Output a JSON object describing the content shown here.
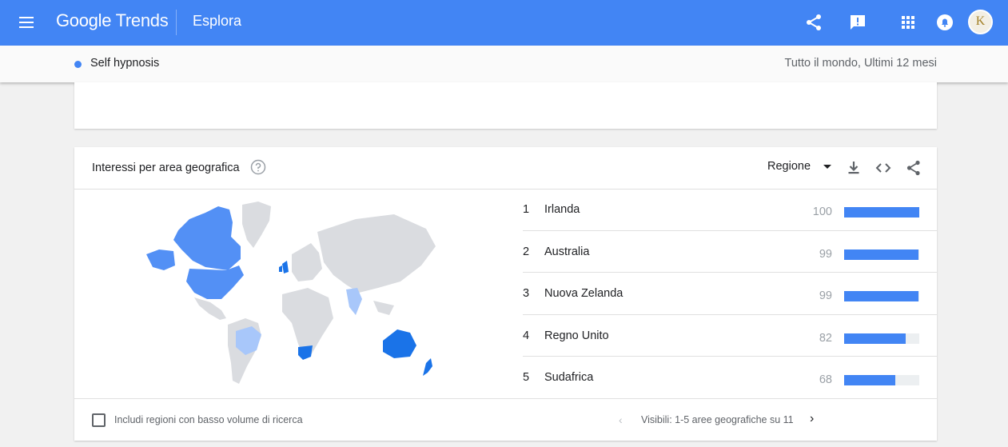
{
  "header": {
    "brand_google": "Google",
    "brand_trends": "Trends",
    "page": "Esplora",
    "icons": [
      "menu-icon",
      "share-icon",
      "feedback-icon",
      "apps-icon",
      "notifications-icon",
      "account-avatar"
    ],
    "avatar_letter": "K"
  },
  "term": {
    "label": "Self hypnosis",
    "filters": "Tutto il mondo, Ultimi 12 mesi"
  },
  "geo_card": {
    "title": "Interessi per area geografica",
    "resolution": "Regione",
    "icons": [
      "help-icon",
      "download-icon",
      "embed-icon",
      "share-icon"
    ],
    "rows": [
      {
        "rank": "1",
        "name": "Irlanda",
        "value": "100",
        "pct": 100
      },
      {
        "rank": "2",
        "name": "Australia",
        "value": "99",
        "pct": 99
      },
      {
        "rank": "3",
        "name": "Nuova Zelanda",
        "value": "99",
        "pct": 99
      },
      {
        "rank": "4",
        "name": "Regno Unito",
        "value": "82",
        "pct": 82
      },
      {
        "rank": "5",
        "name": "Sudafrica",
        "value": "68",
        "pct": 68
      }
    ],
    "low_volume_label": "Includi regioni con basso volume di ricerca",
    "pagination": "Visibili: 1-5 aree geografiche su 11",
    "colors": {
      "accent": "#4285f4",
      "bar_track": "#eceff1",
      "map_strong": "#1a73e8",
      "map_medium": "#5390f5",
      "map_light": "#a8c7fa",
      "map_none": "#dadce0"
    }
  }
}
